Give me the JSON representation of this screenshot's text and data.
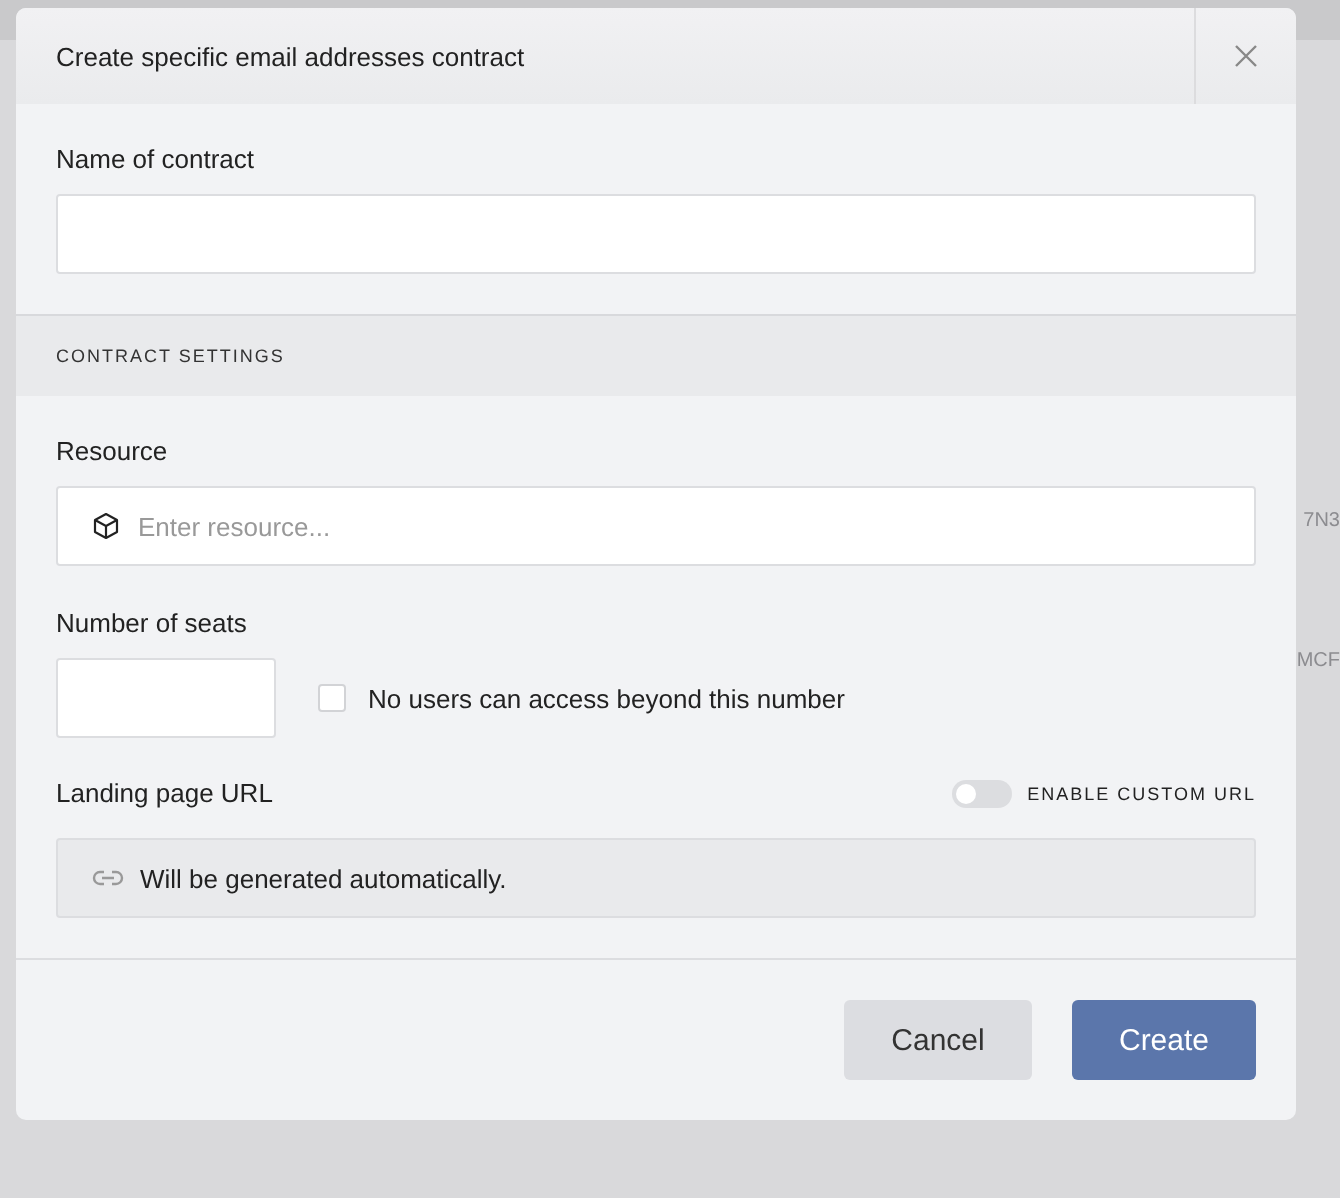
{
  "backdrop_fragments": [
    "7N3",
    "MCF"
  ],
  "dialog": {
    "title": "Create specific email addresses contract",
    "name_field": {
      "label": "Name of contract"
    },
    "section_title": "CONTRACT SETTINGS",
    "resource_field": {
      "label": "Resource",
      "placeholder": "Enter resource..."
    },
    "seats_field": {
      "label": "Number of seats"
    },
    "limit_checkbox": {
      "label": "No users can access beyond this number",
      "checked": false
    },
    "landing_url": {
      "label": "Landing page URL",
      "toggle_label": "ENABLE CUSTOM URL",
      "toggle_on": false,
      "value": "Will be generated automatically."
    },
    "buttons": [
      {
        "label": "Cancel",
        "kind": "secondary"
      },
      {
        "label": "Create",
        "kind": "primary"
      }
    ]
  }
}
